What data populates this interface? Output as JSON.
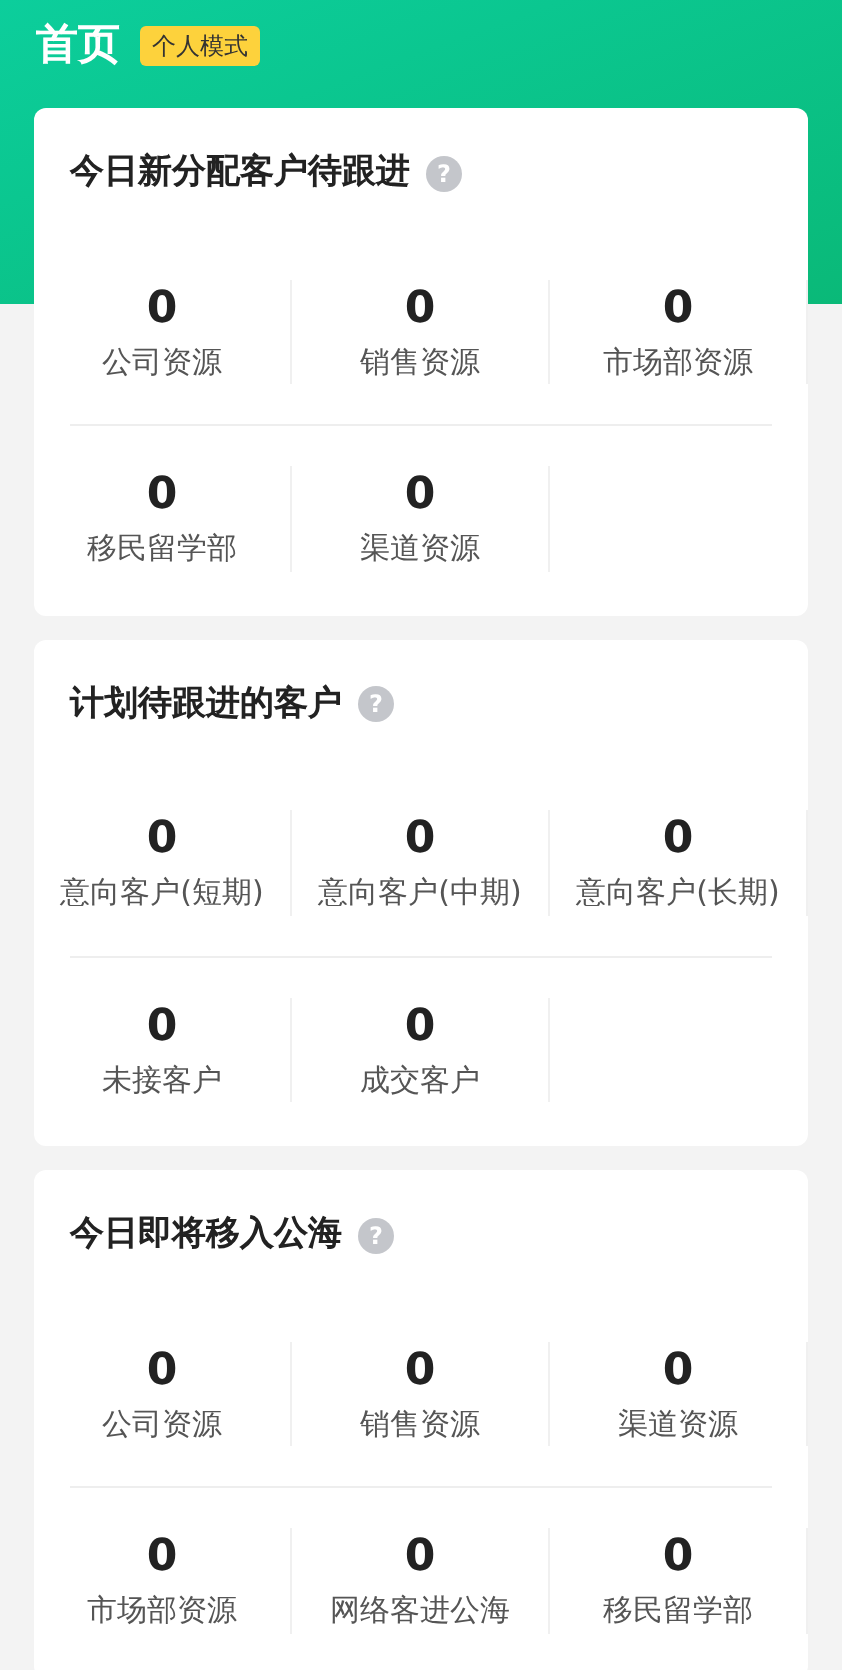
{
  "header": {
    "title": "首页",
    "mode_badge": "个人模式"
  },
  "sections": [
    {
      "title": "今日新分配客户待跟进",
      "help_icon": "?",
      "rows": [
        [
          {
            "value": "0",
            "label": "公司资源"
          },
          {
            "value": "0",
            "label": "销售资源"
          },
          {
            "value": "0",
            "label": "市场部资源"
          }
        ],
        [
          {
            "value": "0",
            "label": "移民留学部"
          },
          {
            "value": "0",
            "label": "渠道资源"
          }
        ]
      ]
    },
    {
      "title": "计划待跟进的客户",
      "help_icon": "?",
      "rows": [
        [
          {
            "value": "0",
            "label": "意向客户(短期)"
          },
          {
            "value": "0",
            "label": "意向客户(中期)"
          },
          {
            "value": "0",
            "label": "意向客户(长期)"
          }
        ],
        [
          {
            "value": "0",
            "label": "未接客户"
          },
          {
            "value": "0",
            "label": "成交客户"
          }
        ]
      ]
    },
    {
      "title": "今日即将移入公海",
      "help_icon": "?",
      "rows": [
        [
          {
            "value": "0",
            "label": "公司资源"
          },
          {
            "value": "0",
            "label": "销售资源"
          },
          {
            "value": "0",
            "label": "渠道资源"
          }
        ],
        [
          {
            "value": "0",
            "label": "市场部资源"
          },
          {
            "value": "0",
            "label": "网络客进公海"
          },
          {
            "value": "0",
            "label": "移民留学部"
          }
        ]
      ]
    }
  ]
}
